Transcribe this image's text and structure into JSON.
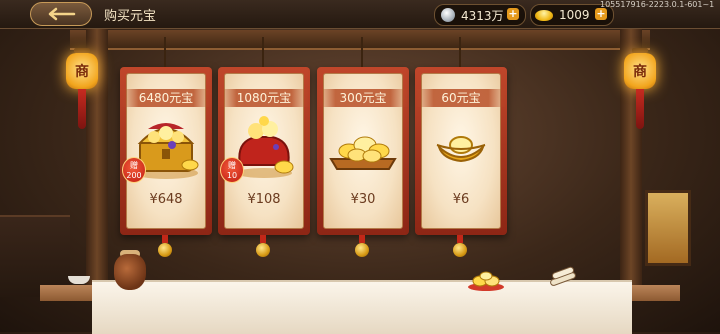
{
  "header": {
    "title": "购买元宝",
    "build_id": "105517916-2223.0.1-601~1",
    "silver": {
      "amount": "4313万",
      "plus": "+"
    },
    "gold": {
      "amount": "1009",
      "plus": "+"
    }
  },
  "lanterns": {
    "left_text": "商",
    "right_text": "商"
  },
  "packages": [
    {
      "title": "6480元宝",
      "price": "¥648",
      "bonus_label": "赠",
      "bonus_value": "200"
    },
    {
      "title": "1080元宝",
      "price": "¥108",
      "bonus_label": "赠",
      "bonus_value": "10"
    },
    {
      "title": "300元宝",
      "price": "¥30"
    },
    {
      "title": "60元宝",
      "price": "¥6"
    }
  ],
  "colors": {
    "accent": "#e59a1d",
    "card": "#c0462a",
    "paper": "#f6e2c3"
  }
}
